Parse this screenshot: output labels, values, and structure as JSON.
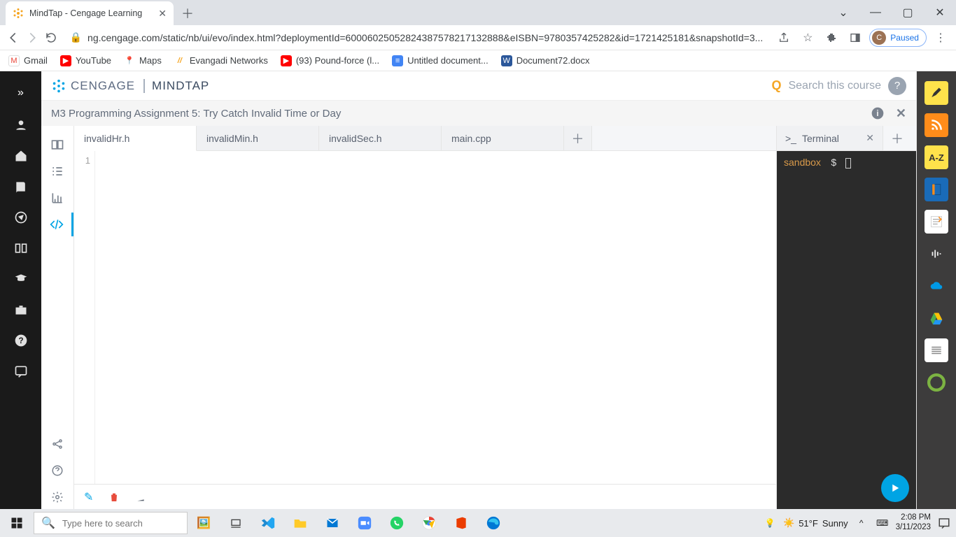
{
  "browser": {
    "tab_title": "MindTap - Cengage Learning",
    "url": "ng.cengage.com/static/nb/ui/evo/index.html?deploymentId=60006025052824387578217132888&eISBN=9780357425282&id=1721425181&snapshotId=3...",
    "paused_label": "Paused",
    "profile_initial": "C"
  },
  "bookmarks": [
    {
      "label": "Gmail",
      "icon": "M",
      "bg": "#ea4335"
    },
    {
      "label": "YouTube",
      "icon": "▶",
      "bg": "#ff0000"
    },
    {
      "label": "Maps",
      "icon": "📍",
      "bg": ""
    },
    {
      "label": "Evangadi Networks",
      "icon": "//",
      "bg": "#f5a623"
    },
    {
      "label": "(93) Pound-force (l...",
      "icon": "▶",
      "bg": "#ff0000"
    },
    {
      "label": "Untitled document...",
      "icon": "≡",
      "bg": "#4285f4"
    },
    {
      "label": "Document72.docx",
      "icon": "W",
      "bg": "#2b579a"
    }
  ],
  "app": {
    "brand_left": "CENGAGE",
    "brand_right": "MINDTAP",
    "search_placeholder": "Search this course",
    "assignment_title": "M3 Programming Assignment 5: Try Catch Invalid Time or Day"
  },
  "editor": {
    "tabs": [
      "invalidHr.h",
      "invalidMin.h",
      "invalidSec.h",
      "main.cpp"
    ],
    "active_tab": 0,
    "gutter_first_line": "1"
  },
  "terminal": {
    "tab_label": "Terminal",
    "prompt_host": "sandbox",
    "prompt_symbol": "$"
  },
  "taskbar": {
    "search_placeholder": "Type here to search",
    "weather_temp": "51°F",
    "weather_desc": "Sunny",
    "time": "2:08 PM",
    "date": "3/11/2023"
  }
}
